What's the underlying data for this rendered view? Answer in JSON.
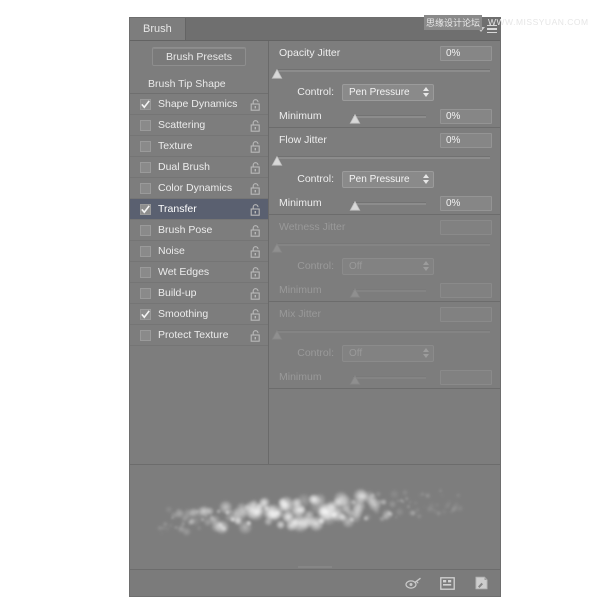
{
  "watermark": {
    "cn_text": "思缘设计论坛",
    "en_text": "WWW.MISSYUAN.COM"
  },
  "panel": {
    "tab_label": "Brush",
    "menu_icon": "panel-menu-icon"
  },
  "sidebar": {
    "presets_button": "Brush Presets",
    "header": "Brush Tip Shape",
    "items": [
      {
        "label": "Shape Dynamics",
        "checked": true,
        "selected": false,
        "locked": true
      },
      {
        "label": "Scattering",
        "checked": false,
        "selected": false,
        "locked": true
      },
      {
        "label": "Texture",
        "checked": false,
        "selected": false,
        "locked": true
      },
      {
        "label": "Dual Brush",
        "checked": false,
        "selected": false,
        "locked": true
      },
      {
        "label": "Color Dynamics",
        "checked": false,
        "selected": false,
        "locked": true
      },
      {
        "label": "Transfer",
        "checked": true,
        "selected": true,
        "locked": true
      },
      {
        "label": "Brush Pose",
        "checked": false,
        "selected": false,
        "locked": true
      },
      {
        "label": "Noise",
        "checked": false,
        "selected": false,
        "locked": true
      },
      {
        "label": "Wet Edges",
        "checked": false,
        "selected": false,
        "locked": true
      },
      {
        "label": "Build-up",
        "checked": false,
        "selected": false,
        "locked": true
      },
      {
        "label": "Smoothing",
        "checked": true,
        "selected": false,
        "locked": true
      },
      {
        "label": "Protect Texture",
        "checked": false,
        "selected": false,
        "locked": true
      }
    ]
  },
  "transfer": {
    "opacity": {
      "title": "Opacity Jitter",
      "value": "0%",
      "slider_percent": 0,
      "control_label": "Control:",
      "control_value": "Pen Pressure",
      "minimum_label": "Minimum",
      "minimum_value": "0%",
      "minimum_percent": 0,
      "enabled": true
    },
    "flow": {
      "title": "Flow Jitter",
      "value": "0%",
      "slider_percent": 0,
      "control_label": "Control:",
      "control_value": "Pen Pressure",
      "minimum_label": "Minimum",
      "minimum_value": "0%",
      "minimum_percent": 0,
      "enabled": true
    },
    "wetness": {
      "title": "Wetness Jitter",
      "value": "",
      "slider_percent": 0,
      "control_label": "Control:",
      "control_value": "Off",
      "minimum_label": "Minimum",
      "minimum_value": "",
      "minimum_percent": 0,
      "enabled": false
    },
    "mix": {
      "title": "Mix Jitter",
      "value": "",
      "slider_percent": 0,
      "control_label": "Control:",
      "control_value": "Off",
      "minimum_label": "Minimum",
      "minimum_value": "",
      "minimum_percent": 0,
      "enabled": false
    }
  },
  "footer": {
    "icons": [
      {
        "name": "toggle-airbrush-icon"
      },
      {
        "name": "brush-presets-panel-icon"
      },
      {
        "name": "new-brush-icon"
      }
    ]
  },
  "colors": {
    "panel_bg": "#7d7d7d",
    "tabbar_bg": "#6f6f6f",
    "selection": "#5a6070",
    "text": "#ececec",
    "text_dim": "#999999",
    "field_bg": "#868686"
  }
}
